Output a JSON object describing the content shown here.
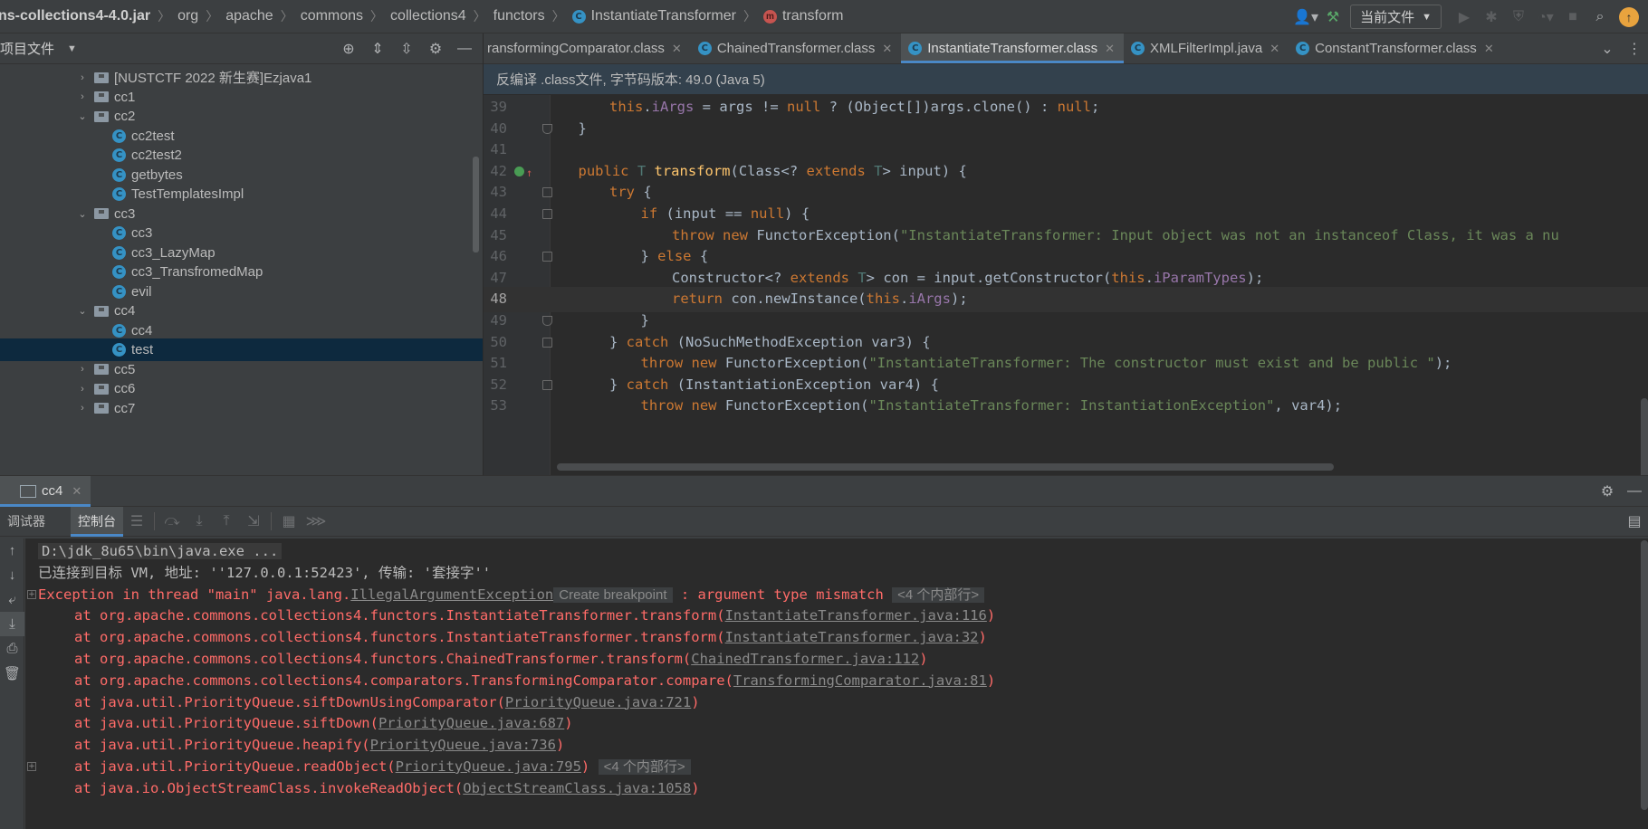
{
  "navbar": {
    "crumbs": [
      {
        "label": "ns-collections4-4.0.jar",
        "icon": ""
      },
      {
        "label": "org",
        "icon": ""
      },
      {
        "label": "apache",
        "icon": ""
      },
      {
        "label": "commons",
        "icon": ""
      },
      {
        "label": "collections4",
        "icon": ""
      },
      {
        "label": "functors",
        "icon": ""
      },
      {
        "label": "InstantiateTransformer",
        "icon": "class-icon"
      },
      {
        "label": "transform",
        "icon": "method-icon"
      }
    ],
    "run_config_label": "当前文件",
    "update_badge": "↑"
  },
  "project": {
    "title": "项目文件",
    "tree": [
      {
        "label": "[NUSTCTF 2022 新生赛]Ezjava1",
        "type": "folder",
        "expanded": false,
        "indent": 1
      },
      {
        "label": "cc1",
        "type": "folder",
        "expanded": false,
        "indent": 1
      },
      {
        "label": "cc2",
        "type": "folder",
        "expanded": true,
        "indent": 1
      },
      {
        "label": "cc2test",
        "type": "class",
        "indent": 2
      },
      {
        "label": "cc2test2",
        "type": "class",
        "indent": 2
      },
      {
        "label": "getbytes",
        "type": "class",
        "indent": 2
      },
      {
        "label": "TestTemplatesImpl",
        "type": "class",
        "indent": 2
      },
      {
        "label": "cc3",
        "type": "folder",
        "expanded": true,
        "indent": 1
      },
      {
        "label": "cc3",
        "type": "class",
        "indent": 2
      },
      {
        "label": "cc3_LazyMap",
        "type": "class",
        "indent": 2
      },
      {
        "label": "cc3_TransfromedMap",
        "type": "class",
        "indent": 2
      },
      {
        "label": "evil",
        "type": "class",
        "indent": 2
      },
      {
        "label": "cc4",
        "type": "folder",
        "expanded": true,
        "indent": 1
      },
      {
        "label": "cc4",
        "type": "class",
        "indent": 2
      },
      {
        "label": "test",
        "type": "class",
        "indent": 2,
        "selected": true
      },
      {
        "label": "cc5",
        "type": "folder",
        "expanded": false,
        "indent": 1
      },
      {
        "label": "cc6",
        "type": "folder",
        "expanded": false,
        "indent": 1
      },
      {
        "label": "cc7",
        "type": "folder",
        "expanded": false,
        "indent": 1
      }
    ]
  },
  "editor": {
    "tabs": [
      {
        "label": "ransformingComparator.class",
        "active": false
      },
      {
        "label": "ChainedTransformer.class",
        "active": false
      },
      {
        "label": "InstantiateTransformer.class",
        "active": true
      },
      {
        "label": "XMLFilterImpl.java",
        "active": false
      },
      {
        "label": "ConstantTransformer.class",
        "active": false
      }
    ],
    "banner": "反编译 .class文件, 字节码版本: 49.0 (Java 5)",
    "current_line": "48",
    "lines": [
      {
        "n": "39",
        "indent": 2,
        "tokens": [
          [
            "kw",
            "this"
          ],
          [
            "",
            "."
          ],
          [
            "fld",
            "iArgs"
          ],
          [
            "",
            " = args != "
          ],
          [
            "kw",
            "null"
          ],
          [
            "",
            " ? (Object[])args.clone() : "
          ],
          [
            "kw",
            "null"
          ],
          [
            "",
            ";"
          ]
        ]
      },
      {
        "n": "40",
        "indent": 1,
        "fold": "end",
        "tokens": [
          [
            "",
            "}"
          ]
        ]
      },
      {
        "n": "41",
        "indent": 0,
        "tokens": []
      },
      {
        "n": "42",
        "indent": 1,
        "override": true,
        "tokens": [
          [
            "kw",
            "public "
          ],
          [
            "tp",
            "T "
          ],
          [
            "mth",
            "transform"
          ],
          [
            "",
            "(Class<? "
          ],
          [
            "kw",
            "extends "
          ],
          [
            "tp",
            "T"
          ],
          [
            "",
            "> input) {"
          ]
        ]
      },
      {
        "n": "43",
        "indent": 2,
        "fold": "start",
        "tokens": [
          [
            "kw",
            "try "
          ],
          [
            "",
            "{"
          ]
        ]
      },
      {
        "n": "44",
        "indent": 3,
        "fold": "start",
        "tokens": [
          [
            "kw",
            "if "
          ],
          [
            "",
            "(input == "
          ],
          [
            "kw",
            "null"
          ],
          [
            "",
            ") {"
          ]
        ]
      },
      {
        "n": "45",
        "indent": 4,
        "tokens": [
          [
            "kw",
            "throw new "
          ],
          [
            "",
            "FunctorException("
          ],
          [
            "str",
            "\"InstantiateTransformer: Input object was not an instanceof Class, it was a nu"
          ]
        ]
      },
      {
        "n": "46",
        "indent": 3,
        "fold": "mid",
        "tokens": [
          [
            "",
            "} "
          ],
          [
            "kw",
            "else "
          ],
          [
            "",
            "{"
          ]
        ]
      },
      {
        "n": "47",
        "indent": 4,
        "tokens": [
          [
            "",
            "Constructor<? "
          ],
          [
            "kw",
            "extends "
          ],
          [
            "tp",
            "T"
          ],
          [
            "",
            "> con = input.getConstructor("
          ],
          [
            "kw",
            "this"
          ],
          [
            "",
            "."
          ],
          [
            "fld",
            "iParamTypes"
          ],
          [
            "",
            ");"
          ]
        ]
      },
      {
        "n": "48",
        "indent": 4,
        "tokens": [
          [
            "kw",
            "return "
          ],
          [
            "",
            "con.newInstance("
          ],
          [
            "kw",
            "this"
          ],
          [
            "",
            "."
          ],
          [
            "fld",
            "iArgs"
          ],
          [
            "",
            ");"
          ]
        ]
      },
      {
        "n": "49",
        "indent": 3,
        "fold": "end",
        "tokens": [
          [
            "",
            "}"
          ]
        ]
      },
      {
        "n": "50",
        "indent": 2,
        "fold": "mid",
        "tokens": [
          [
            "",
            "} "
          ],
          [
            "kw",
            "catch "
          ],
          [
            "",
            "(NoSuchMethodException var3) {"
          ]
        ]
      },
      {
        "n": "51",
        "indent": 3,
        "tokens": [
          [
            "kw",
            "throw new "
          ],
          [
            "",
            "FunctorException("
          ],
          [
            "str",
            "\"InstantiateTransformer: The constructor must exist and be public \""
          ],
          [
            "",
            ");"
          ]
        ]
      },
      {
        "n": "52",
        "indent": 2,
        "fold": "mid",
        "tokens": [
          [
            "",
            "} "
          ],
          [
            "kw",
            "catch "
          ],
          [
            "",
            "(InstantiationException var4) {"
          ]
        ]
      },
      {
        "n": "53",
        "indent": 3,
        "tokens": [
          [
            "kw",
            "throw new "
          ],
          [
            "",
            "FunctorException("
          ],
          [
            "str",
            "\"InstantiateTransformer: InstantiationException\""
          ],
          [
            "",
            ", var4);"
          ]
        ]
      }
    ]
  },
  "debug": {
    "tab_label": "cc4",
    "subtabs": [
      "调试器",
      "控制台"
    ],
    "active_subtab": 1,
    "console": [
      {
        "kind": "cmd",
        "text": "D:\\jdk_8u65\\bin\\java.exe ..."
      },
      {
        "kind": "info",
        "text": "已连接到目标 VM, 地址: ''127.0.0.1:52423', 传输: '套接字''"
      },
      {
        "kind": "exception",
        "prefix": "Exception in thread \"main\" java.lang.",
        "link": "IllegalArgumentException",
        "badge": "Create breakpoint",
        "suffix": " : argument type mismatch ",
        "badge2": "<4 个内部行>"
      },
      {
        "kind": "frame",
        "text": "at org.apache.commons.collections4.functors.InstantiateTransformer.transform(",
        "link": "InstantiateTransformer.java:116",
        "end": ")"
      },
      {
        "kind": "frame",
        "text": "at org.apache.commons.collections4.functors.InstantiateTransformer.transform(",
        "link": "InstantiateTransformer.java:32",
        "end": ")"
      },
      {
        "kind": "frame",
        "text": "at org.apache.commons.collections4.functors.ChainedTransformer.transform(",
        "link": "ChainedTransformer.java:112",
        "end": ")"
      },
      {
        "kind": "frame",
        "text": "at org.apache.commons.collections4.comparators.TransformingComparator.compare(",
        "link": "TransformingComparator.java:81",
        "end": ")"
      },
      {
        "kind": "frame",
        "text": "at java.util.PriorityQueue.siftDownUsingComparator(",
        "link": "PriorityQueue.java:721",
        "end": ")"
      },
      {
        "kind": "frame",
        "text": "at java.util.PriorityQueue.siftDown(",
        "link": "PriorityQueue.java:687",
        "end": ")"
      },
      {
        "kind": "frame",
        "text": "at java.util.PriorityQueue.heapify(",
        "link": "PriorityQueue.java:736",
        "end": ")"
      },
      {
        "kind": "frame",
        "text": "at java.util.PriorityQueue.readObject(",
        "link": "PriorityQueue.java:795",
        "end": ")",
        "badge2": "<4 个内部行>",
        "expand": true
      },
      {
        "kind": "frame",
        "text": "at java.io.ObjectStreamClass.invokeReadObject(",
        "link": "ObjectStreamClass.java:1058",
        "end": ")"
      }
    ]
  },
  "colors": {
    "background": "#2b2b2b",
    "panel": "#3c3f41",
    "accent": "#4a88c7",
    "error": "#ff6b68",
    "keyword": "#cc7832",
    "string": "#6a8759",
    "field": "#9876aa",
    "method": "#ffc66d"
  }
}
